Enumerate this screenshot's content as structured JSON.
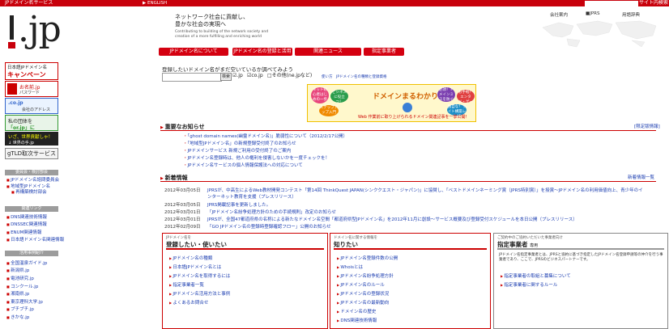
{
  "topbar": {
    "brand": "JPドメイン名サービス",
    "english": "▶ ENGLISH",
    "site_search": "サイト内検索"
  },
  "header": {
    "logo": ".jp",
    "tagline": [
      "ネットワーク社会に貢献し、",
      "豊かな社会の実現へ"
    ],
    "tagline_en": [
      "Contributing to building of the network society and",
      "creation of a more fulfilling and enriching world"
    ],
    "links": [
      "会社案内",
      "■JPRS",
      "用語辞典"
    ]
  },
  "nav": [
    "JPドメイン名について",
    "JPドメイン名の登録と活用",
    "関連ニュース",
    "指定事業者"
  ],
  "left": {
    "banners": [
      {
        "lines": [
          "日本語JPドメイン名",
          "キャンペーン"
        ]
      },
      {
        "lines": [
          "お名前.jp",
          "パスワード"
        ]
      },
      {
        "lines": [
          ".co.jp",
          "会社のアドレス"
        ]
      },
      {
        "lines": [
          "私の団体を",
          "「or.jp」に"
        ]
      },
      {
        "lines": [
          "いざ、世界貢献しゃ！",
          "↓ 世界の手.jp"
        ]
      }
    ],
    "gtld": "gTLD取次サービス",
    "sections": [
      {
        "title": "委員会・検討部会",
        "items": [
          "JPドメイン名諮問委員会",
          "地域型JPドメイン名",
          "再構築検討部会"
        ]
      },
      {
        "title": "関連リンク",
        "items": [
          "DNS関連技術情報",
          "DNSSEC関連情報",
          "ENUM関連情報",
          "日本語ドメイン名関連情報"
        ]
      },
      {
        "title": "活用事例紹介",
        "items": [
          "全国温泉ガイド.jp",
          "新潟県.jp",
          "電池研究.jp",
          "コンクール.jp",
          "湘南県.jp",
          "東京理科大学.jp",
          "ブチブチ.jp",
          "きかな.jp"
        ]
      }
    ]
  },
  "query": {
    "title": "登録したいドメイン名がまだ空いているか調べてみよう",
    "button": "検索",
    "options": [
      "☑.jp",
      "☑co.jp",
      "□その他(ne.jpなど)"
    ],
    "link": "使い方　JPドメイン名の種類と登録資格"
  },
  "promo": {
    "title": "ドメインまるわかり.jp",
    "sub": "Web 作業前に取り上げられるドメイン関連記事を一挙公開！",
    "bubbles": [
      "ネット初心者はじめの一歩",
      "ビジネスに役立つ！",
      "ステップアップ入門",
      "必須！ドメインミスを防ぐ",
      "お手軽！エンタメ・ゲーム",
      "独自な！サイト構築レシピ"
    ]
  },
  "important": {
    "title": "重要なお知らせ",
    "more": "[限定版情報]",
    "items": [
      "「ghost domain names(幽霊ドメイン名)」脆弱性について（2012/2/17公開）",
      "「地域型JPドメイン名」の新規登録受付終了のお知らせ",
      "JPドメインサービス 新規ご利用の受付終了のご案内",
      "JPドメイン名登録時は、他人の権利を侵害しないかを一度チェックを！",
      "JPドメイン名サービスの個人情報保護法への対応について"
    ]
  },
  "news": {
    "title": "新着情報",
    "more": "新着情報一覧",
    "items": [
      {
        "date": "2012年03月05日",
        "text": "JPRSが、中高生によるWeb教材開発コンテスト「第14回 ThinkQuest JAPAN(シンククエスト・ジャパン)」に協賛し、「ベストドメインネーミング賞（JPRS特別賞）」を授賞〜JPドメイン名の利用価値向上、青少年のイ"
      },
      {
        "date": "",
        "text": "ンターネット教育を支援（プレスリリース）"
      },
      {
        "date": "2012年03月05日",
        "text": "JPRS掲載記事を更新しました。"
      },
      {
        "date": "2012年03月01日",
        "text": "「JPドメイン名紛争処理方針のための手続規則」改定のお知らせ"
      },
      {
        "date": "2012年03月01日",
        "text": "JPRSが、全国47都道府県の名称による新たなドメイン名空間「都道府県型JPドメイン名」を2012年11月に創設〜サービス概要及び登録受付スケジュールを本日公開（プレスリリース）"
      },
      {
        "date": "2012年02月09日",
        "text": "「GO JPドメイン名の登録時登録確認フロー」公開のお知らせ"
      }
    ]
  },
  "boxes": [
    {
      "small": "JPドメイン名を",
      "head": "登録したい・使いたい",
      "items": [
        "JPドメイン名の種類",
        "日本語JPドメイン名とは",
        "JPドメイン名を取得するには",
        "指定事業者一覧",
        "JPドメイン名活用方法と事例",
        "よくあるお問合せ"
      ]
    },
    {
      "small": "ドメイン名に関する情報を",
      "head": "知りたい",
      "items": [
        "JPドメイン名登録件数の公開",
        "Whoisとは",
        "JPドメイン名紛争処理方針",
        "JPドメイン名のルール",
        "JPドメイン名の登録状況",
        "JPドメイン名の最新動向",
        "ドメイン名の歴史",
        "DNS関連技術情報"
      ]
    },
    {
      "small": "ご契約中のご協約いただいた事業者向け",
      "head": "指定事業者",
      "head_tag": "専用",
      "desc": "JPドメイン名指定事業者とは、JPRSと協約に基づき指定したJPドメイン名登録申請等の仲介を行う事業者であり、ここで、JPRSのビジネスパートナーです。",
      "items": [
        "指定事業者の取組と募集について",
        "指定事業者に関するルール"
      ]
    }
  ]
}
